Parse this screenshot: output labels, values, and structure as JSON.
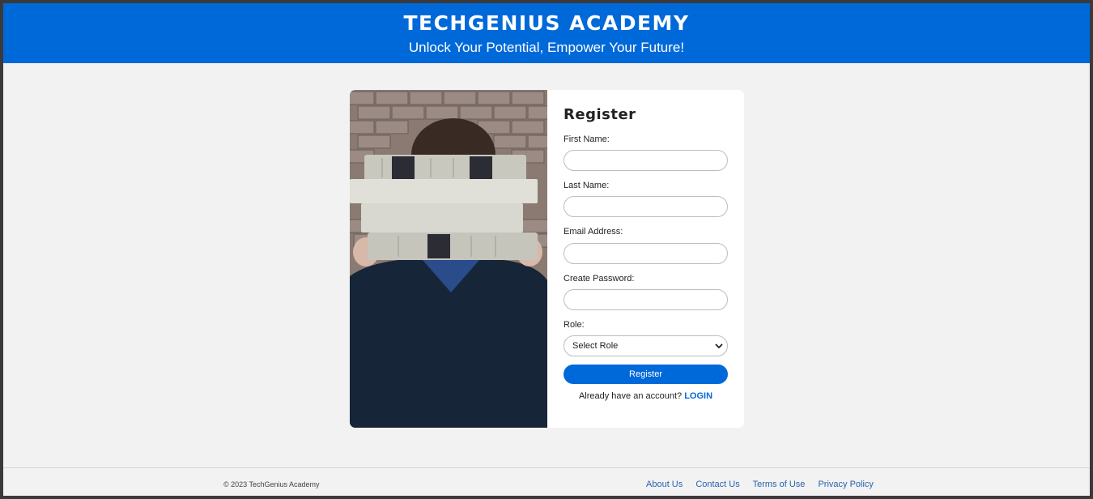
{
  "header": {
    "title": "TECHGENIUS ACADEMY",
    "tagline": "Unlock Your Potential, Empower Your Future!"
  },
  "form": {
    "heading": "Register",
    "fields": [
      {
        "label": "First Name:",
        "value": "",
        "placeholder": ""
      },
      {
        "label": "Last Name:",
        "value": "",
        "placeholder": ""
      },
      {
        "label": "Email Address:",
        "value": "",
        "placeholder": ""
      },
      {
        "label": "Create Password:",
        "value": "",
        "placeholder": ""
      }
    ],
    "role": {
      "label": "Role:",
      "selected": "Select Role"
    },
    "submit_label": "Register",
    "login_prompt": "Already have an account?",
    "login_link": "LOGIN"
  },
  "footer": {
    "copyright": "© 2023 TechGenius Academy",
    "links": [
      "About Us",
      "Contact Us",
      "Terms of Use",
      "Privacy Policy"
    ]
  },
  "colors": {
    "brand": "#0069d9",
    "background": "#f2f2f2",
    "link": "#2a62b0"
  },
  "icons": {
    "select_arrow": "chevron-down-icon"
  }
}
